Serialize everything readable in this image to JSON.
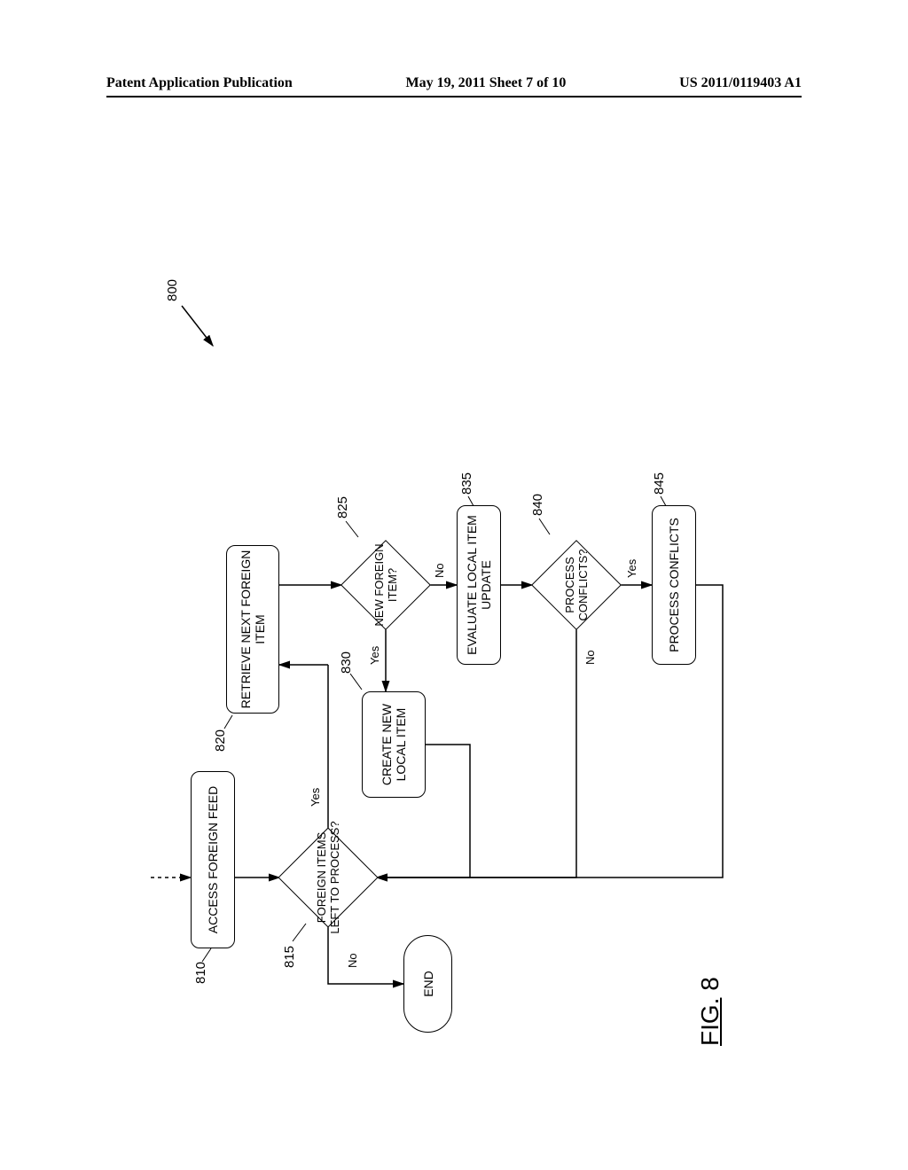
{
  "header": {
    "left": "Patent Application Publication",
    "center": "May 19, 2011  Sheet 7 of 10",
    "right": "US 2011/0119403 A1"
  },
  "figure": {
    "caption_prefix": "FIG.",
    "caption_number": "8",
    "flow_ref": "800",
    "boxes": {
      "access_feed": "Access Foreign Feed",
      "retrieve_next": "Retrieve Next Foreign Item",
      "create_local": "Create New Local Item",
      "evaluate_local": "Evaluate Local Item Update",
      "process_conflicts": "Process Conflicts"
    },
    "decisions": {
      "items_left": "Foreign Items Left to Process?",
      "new_item": "New Foreign Item?",
      "conflicts": "Process Conflicts?"
    },
    "terminator": {
      "end": "End"
    },
    "edge_labels": {
      "yes": "Yes",
      "no": "No"
    },
    "refs": {
      "r810": "810",
      "r815": "815",
      "r820": "820",
      "r825": "825",
      "r830": "830",
      "r835": "835",
      "r840": "840",
      "r845": "845"
    }
  }
}
